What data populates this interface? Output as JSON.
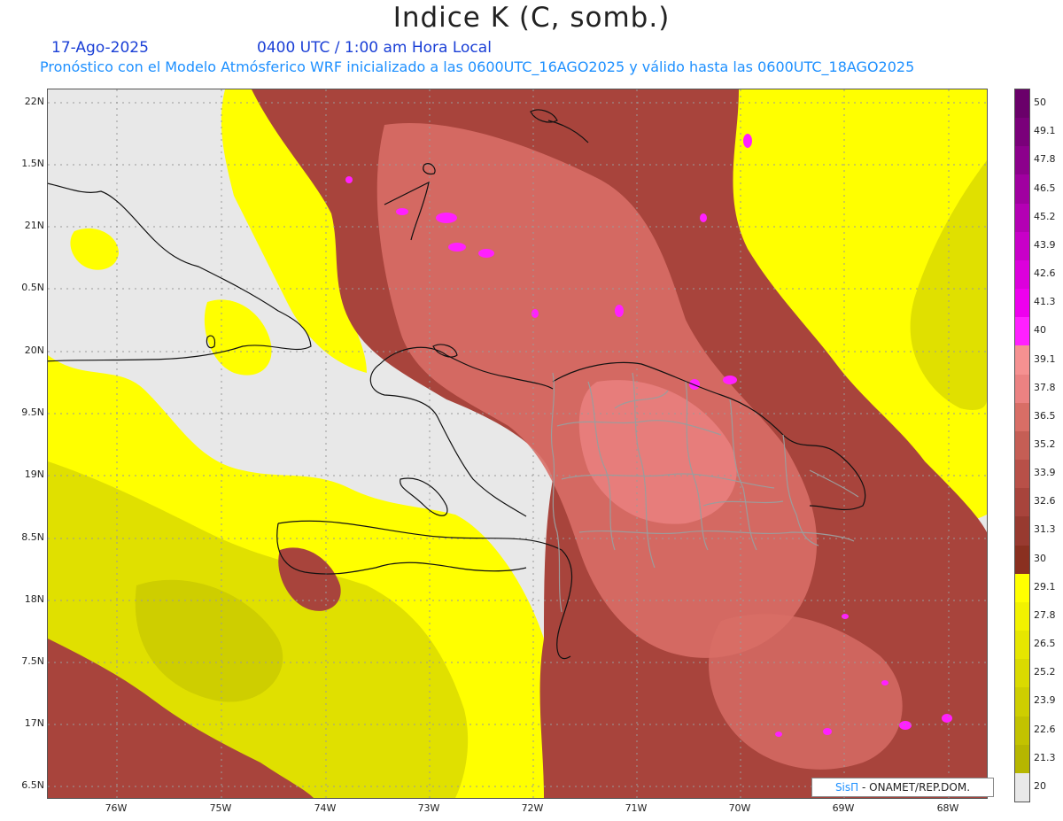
{
  "header": {
    "title": "Indice K (C, somb.)",
    "date": "17-Ago-2025",
    "time": "0400 UTC / 1:00 am Hora Local",
    "subtitle": "Pronóstico con el Modelo Atmósferico WRF inicializado a las 0600UTC_16AGO2025 y válido hasta las  0600UTC_18AGO2025"
  },
  "axes": {
    "lat_labels": [
      "22N",
      "1.5N",
      "21N",
      "0.5N",
      "20N",
      "9.5N",
      "19N",
      "8.5N",
      "18N",
      "7.5N",
      "17N",
      "6.5N"
    ],
    "lon_labels": [
      "76W",
      "75W",
      "74W",
      "73W",
      "72W",
      "71W",
      "70W",
      "69W",
      "68W"
    ]
  },
  "legend": {
    "labels": [
      "50",
      "49.1",
      "47.8",
      "46.5",
      "45.2",
      "43.9",
      "42.6",
      "41.3",
      "40",
      "39.1",
      "37.8",
      "36.5",
      "35.2",
      "33.9",
      "32.6",
      "31.3",
      "30",
      "29.1",
      "27.8",
      "26.5",
      "25.2",
      "23.9",
      "22.6",
      "21.3",
      "20"
    ],
    "colors": [
      "#6a006a",
      "#7a007a",
      "#8c008c",
      "#a000a0",
      "#b400b4",
      "#c800c8",
      "#dc00dc",
      "#ee00ee",
      "#ff20ff",
      "#f59191",
      "#eb8282",
      "#d86e66",
      "#c55e55",
      "#b85048",
      "#a8443c",
      "#983a30",
      "#8a3020",
      "#ffff00",
      "#f2f200",
      "#e6e600",
      "#dada00",
      "#cece00",
      "#c2c200",
      "#b6b600",
      "#e8e8e8"
    ]
  },
  "credit": {
    "brand": "SisΠ",
    "text": "- ONAMET/REP.DOM."
  },
  "colors": {
    "background": "#ffffff",
    "no_data": "#e8e8e8",
    "yellow": "#ffff00",
    "olive": "#dada00",
    "brown": "#a8443c",
    "salmon": "#d86e66",
    "magenta": "#ff20ff"
  }
}
